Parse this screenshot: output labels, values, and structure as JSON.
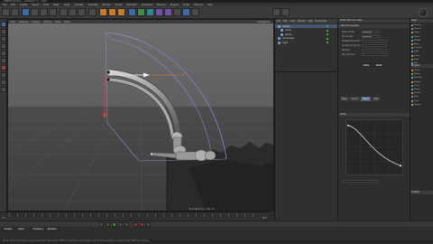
{
  "window": {
    "title": "CINEMA 4D R14 — [Untitled 1 *] — Main"
  },
  "menubar": {
    "items": [
      "File",
      "Edit",
      "Create",
      "Select",
      "Tools",
      "Mesh",
      "Snap",
      "Animate",
      "Simulate",
      "Render",
      "Sculpt",
      "MoGraph",
      "Character",
      "Pipeline",
      "Plugins",
      "Script",
      "Window",
      "Help"
    ]
  },
  "viewport": {
    "header_items": [
      "View",
      "Cameras",
      "Display",
      "Options",
      "Filter",
      "Panel"
    ],
    "title": "Perspective",
    "grid_label": "Grid Spacing : 100 cm"
  },
  "object_manager": {
    "menu": [
      "File",
      "Edit",
      "View",
      "Objects",
      "Tags",
      "Bookmarks"
    ],
    "objects": [
      {
        "name": "Sweep"
      },
      {
        "name": "Circle"
      },
      {
        "name": "Spline"
      },
      {
        "name": "Landscape"
      },
      {
        "name": "Light"
      }
    ]
  },
  "attributes": {
    "section_mode": "Mode  Edit  User Data",
    "section_object": "Object Properties",
    "fields": [
      {
        "label": "Start Growth"
      },
      {
        "label": "End Growth"
      },
      {
        "label": "Parallel Movement"
      },
      {
        "label": "Constant Cross Section"
      },
      {
        "label": "Banking"
      },
      {
        "label": "Rail Direction"
      }
    ],
    "buttons": [
      "Apply",
      "Reset"
    ],
    "tabs": [
      "Basic",
      "Coord.",
      "Object",
      "Caps"
    ],
    "active_tab": "Object",
    "curve_title": "Scale"
  },
  "right_panel": {
    "heads": [
      "Layer",
      "Browser",
      "Content"
    ],
    "items": [
      "Deform",
      "Effector",
      "Object",
      "Spline",
      "NURBS",
      "Array",
      "Camera",
      "Light",
      "Scene",
      "Floor",
      "Sky",
      "Cloner",
      "Matrix",
      "Random",
      "Shader",
      "Delay",
      "Target",
      "Sound",
      "Step",
      "Time",
      "Volume"
    ]
  },
  "timeline": {
    "start": "0 F",
    "end": "90 F"
  },
  "bottom_tabs": [
    "Create",
    "Edit",
    "Function",
    "Texture"
  ],
  "status": "Move: Click and drag to move elements. Hold down SHIFT to quantize movement / add to the selection in point mode, CTRL to remove."
}
